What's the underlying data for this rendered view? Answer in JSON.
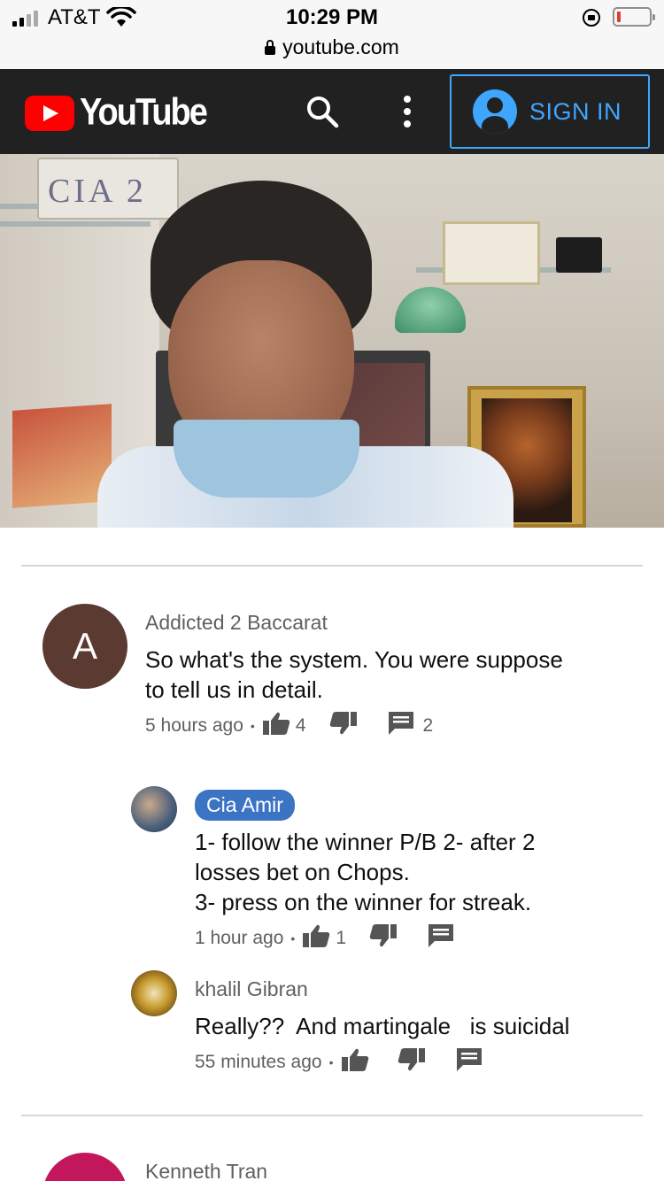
{
  "status_bar": {
    "carrier": "AT&T",
    "time": "10:29 PM",
    "url": "youtube.com"
  },
  "header": {
    "logo_text": "YouTube",
    "sign_in_label": "SIGN IN",
    "colors": {
      "header_bg": "#212121",
      "brand_red": "#ff0000",
      "accent_blue": "#3ea6ff"
    }
  },
  "comments": [
    {
      "author": "Addicted 2 Baccarat",
      "avatar_letter": "A",
      "avatar_color": "#5b3a31",
      "lines": [
        "So what's the system. You were suppose",
        "to tell us in detail."
      ],
      "time": "5 hours ago",
      "likes": "4",
      "replies": "2"
    },
    {
      "author": "Cia Amir",
      "lines": [
        "1- follow the winner P/B 2- after 2",
        "losses bet on Chops.",
        "3- press on the winner for streak."
      ],
      "time": "1 hour ago",
      "likes": "1"
    },
    {
      "author": "khalil Gibran",
      "lines": [
        "Really??  And martingale   is suicidal"
      ],
      "time": "55 minutes ago"
    },
    {
      "author": "Kenneth Tran",
      "avatar_color": "#c2185b"
    }
  ]
}
